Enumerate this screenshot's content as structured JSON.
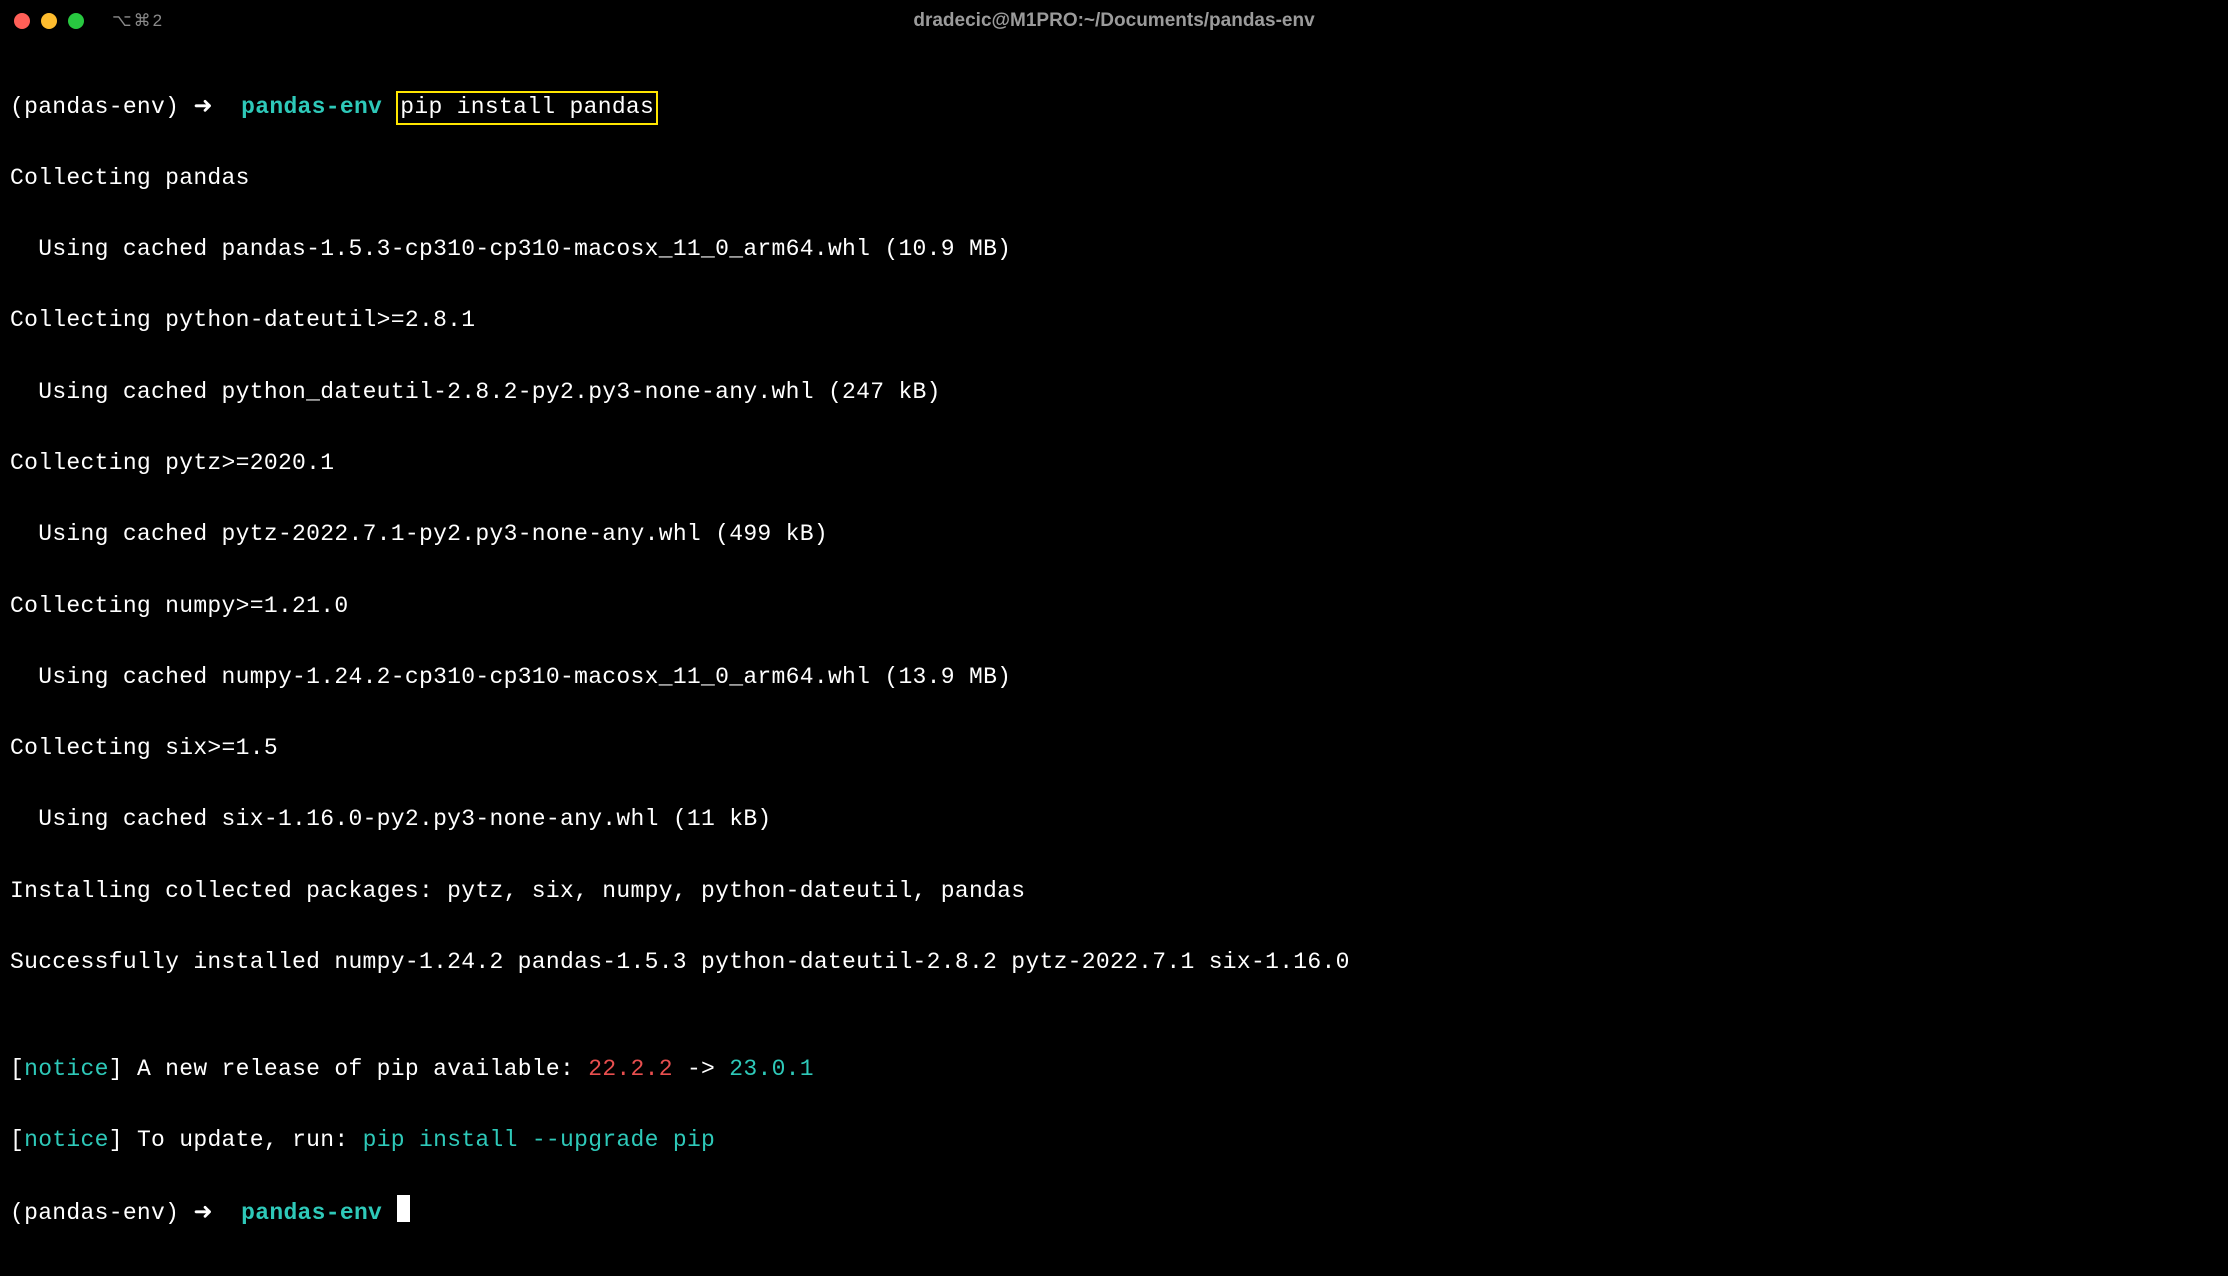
{
  "titlebar": {
    "tab_indicator": "⌥⌘2",
    "title": "dradecic@M1PRO:~/Documents/pandas-env"
  },
  "prompt1": {
    "venv": "(pandas-env)",
    "arrow": "➜",
    "dir": "pandas-env",
    "command": "pip install pandas"
  },
  "out": {
    "l01": "Collecting pandas",
    "l02": "  Using cached pandas-1.5.3-cp310-cp310-macosx_11_0_arm64.whl (10.9 MB)",
    "l03": "Collecting python-dateutil>=2.8.1",
    "l04": "  Using cached python_dateutil-2.8.2-py2.py3-none-any.whl (247 kB)",
    "l05": "Collecting pytz>=2020.1",
    "l06": "  Using cached pytz-2022.7.1-py2.py3-none-any.whl (499 kB)",
    "l07": "Collecting numpy>=1.21.0",
    "l08": "  Using cached numpy-1.24.2-cp310-cp310-macosx_11_0_arm64.whl (13.9 MB)",
    "l09": "Collecting six>=1.5",
    "l10": "  Using cached six-1.16.0-py2.py3-none-any.whl (11 kB)",
    "l11": "Installing collected packages: pytz, six, numpy, python-dateutil, pandas",
    "l12": "Successfully installed numpy-1.24.2 pandas-1.5.3 python-dateutil-2.8.2 pytz-2022.7.1 six-1.16.0",
    "l13": ""
  },
  "notice1": {
    "bracket_open": "[",
    "tag": "notice",
    "bracket_close": "]",
    "text": " A new release of pip available: ",
    "old": "22.2.2",
    "arrow": " -> ",
    "new": "23.0.1"
  },
  "notice2": {
    "bracket_open": "[",
    "tag": "notice",
    "bracket_close": "]",
    "text": " To update, run: ",
    "cmd": "pip install --upgrade pip"
  },
  "prompt2": {
    "venv": "(pandas-env)",
    "arrow": "➜",
    "dir": "pandas-env"
  }
}
